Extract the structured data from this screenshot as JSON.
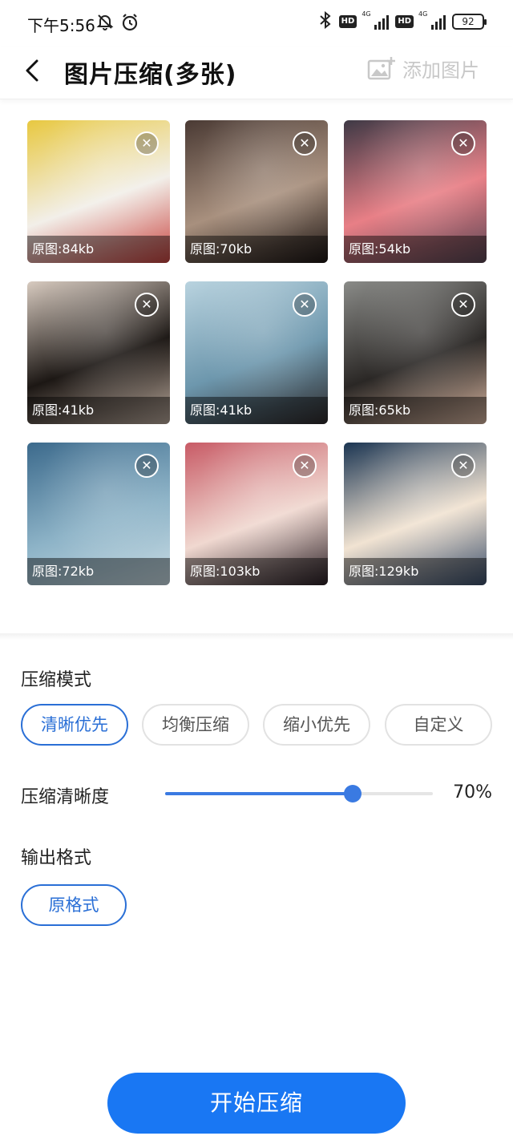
{
  "status_bar": {
    "time": "下午5:56",
    "icons": [
      "bell-off-icon",
      "alarm-icon",
      "bluetooth-icon",
      "hd-icon",
      "signal-4g-icon",
      "hd-icon",
      "signal-4g-icon",
      "battery-icon"
    ],
    "hd_label": "HD",
    "network_label": "4G",
    "battery": "92"
  },
  "header": {
    "title": "图片压缩(多张)",
    "add_label": "添加图片"
  },
  "images": [
    {
      "size_label": "原图:84kb",
      "colors": [
        "#e8c840",
        "#f2efe9",
        "#c94440"
      ]
    },
    {
      "size_label": "原图:70kb",
      "colors": [
        "#4a3a34",
        "#a8907e",
        "#1d1614"
      ]
    },
    {
      "size_label": "原图:54kb",
      "colors": [
        "#3e3945",
        "#e87f86",
        "#5a4654"
      ]
    },
    {
      "size_label": "原图:41kb",
      "colors": [
        "#d8cbc0",
        "#1c1714",
        "#b9a89b"
      ]
    },
    {
      "size_label": "原图:41kb",
      "colors": [
        "#b9d3df",
        "#6d97ad",
        "#2e2a2b"
      ]
    },
    {
      "size_label": "原图:65kb",
      "colors": [
        "#8a8b88",
        "#2a2725",
        "#d7b5a0"
      ]
    },
    {
      "size_label": "原图:72kb",
      "colors": [
        "#3c6a8c",
        "#8db3c7",
        "#c9dce4"
      ]
    },
    {
      "size_label": "原图:103kb",
      "colors": [
        "#c85b66",
        "#f0d8d0",
        "#2b2026"
      ]
    },
    {
      "size_label": "原图:129kb",
      "colors": [
        "#1b3552",
        "#f1e3d2",
        "#3b4f6c"
      ]
    }
  ],
  "compress_mode": {
    "label": "压缩模式",
    "options": [
      "清晰优先",
      "均衡压缩",
      "缩小优先",
      "自定义"
    ],
    "selected": "清晰优先"
  },
  "clarity": {
    "label": "压缩清晰度",
    "value": 70,
    "value_label": "70%"
  },
  "output_format": {
    "label": "输出格式",
    "selected": "原格式"
  },
  "start_button": "开始压缩",
  "colors": {
    "accent": "#1977f3",
    "chip_active": "#2a6fd6",
    "slider": "#3a7ae2"
  }
}
